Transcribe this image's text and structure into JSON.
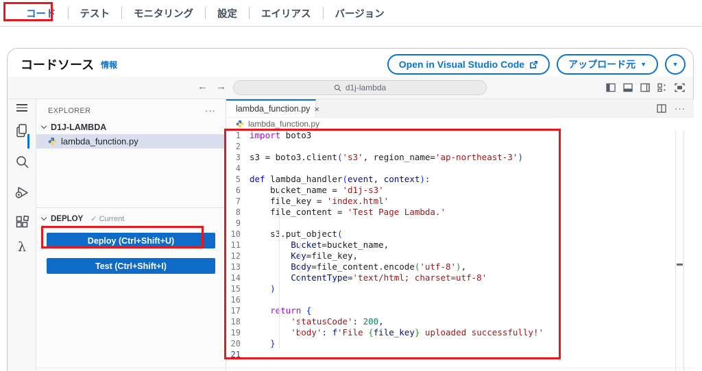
{
  "nav": {
    "tabs": [
      {
        "label": "コード",
        "active": true
      },
      {
        "label": "テスト"
      },
      {
        "label": "モニタリング"
      },
      {
        "label": "設定"
      },
      {
        "label": "エイリアス"
      },
      {
        "label": "バージョン"
      }
    ]
  },
  "header": {
    "title": "コードソース",
    "info_link": "情報",
    "open_vscode_button": "Open in Visual Studio Code",
    "upload_button": "アップロード元"
  },
  "toolbar": {
    "search_value": "d1j-lambda"
  },
  "explorer": {
    "header": "EXPLORER",
    "folder": "D1J-LAMBDA",
    "file": "lambda_function.py",
    "deploy_label": "DEPLOY",
    "deploy_status": "Current",
    "deploy_button": "Deploy (Ctrl+Shift+U)",
    "test_button": "Test (Ctrl+Shift+I)"
  },
  "editor": {
    "tab_label": "lambda_function.py",
    "breadcrumb": "lambda_function.py",
    "lines": [
      {
        "n": 1,
        "t": [
          [
            "kw1",
            "import"
          ],
          [
            "def",
            " boto3"
          ]
        ]
      },
      {
        "n": 2,
        "t": []
      },
      {
        "n": 3,
        "t": [
          [
            "def",
            "s3 = boto3."
          ],
          [
            "fn",
            "client"
          ],
          [
            "br1",
            "("
          ],
          [
            "str",
            "'s3'"
          ],
          [
            "def",
            ", region_name="
          ],
          [
            "str",
            "'ap-northeast-3'"
          ],
          [
            "br1",
            ")"
          ]
        ]
      },
      {
        "n": 4,
        "t": []
      },
      {
        "n": 5,
        "t": [
          [
            "kw2",
            "def "
          ],
          [
            "fn",
            "lambda_handler"
          ],
          [
            "br1",
            "("
          ],
          [
            "var",
            "event"
          ],
          [
            "def",
            ", "
          ],
          [
            "var",
            "context"
          ],
          [
            "br1",
            ")"
          ],
          [
            "def",
            ":"
          ]
        ]
      },
      {
        "n": 6,
        "t": [
          [
            "def",
            "    bucket_name = "
          ],
          [
            "str",
            "'d1j-s3'"
          ]
        ]
      },
      {
        "n": 7,
        "t": [
          [
            "def",
            "    file_key = "
          ],
          [
            "str",
            "'index.html'"
          ]
        ]
      },
      {
        "n": 8,
        "t": [
          [
            "def",
            "    file_content = "
          ],
          [
            "str",
            "'Test Page Lambda.'"
          ]
        ]
      },
      {
        "n": 9,
        "t": []
      },
      {
        "n": 10,
        "t": [
          [
            "def",
            "    s3."
          ],
          [
            "fn",
            "put_object"
          ],
          [
            "br1",
            "("
          ]
        ]
      },
      {
        "n": 11,
        "t": [
          [
            "var",
            "        Bucket"
          ],
          [
            "def",
            "=bucket_name,"
          ]
        ]
      },
      {
        "n": 12,
        "t": [
          [
            "var",
            "        Key"
          ],
          [
            "def",
            "=file_key,"
          ]
        ]
      },
      {
        "n": 13,
        "t": [
          [
            "var",
            "        Body"
          ],
          [
            "def",
            "=file_content."
          ],
          [
            "fn",
            "encode"
          ],
          [
            "br2",
            "("
          ],
          [
            "str",
            "'utf-8'"
          ],
          [
            "br2",
            ")"
          ],
          [
            "def",
            ","
          ]
        ]
      },
      {
        "n": 14,
        "t": [
          [
            "var",
            "        ContentType"
          ],
          [
            "def",
            "="
          ],
          [
            "str",
            "'text/html; charset=utf-8'"
          ]
        ]
      },
      {
        "n": 15,
        "t": [
          [
            "def",
            "    "
          ],
          [
            "br1",
            ")"
          ]
        ]
      },
      {
        "n": 16,
        "t": []
      },
      {
        "n": 17,
        "t": [
          [
            "kw1",
            "    return "
          ],
          [
            "br1",
            "{"
          ]
        ]
      },
      {
        "n": 18,
        "t": [
          [
            "def",
            "        "
          ],
          [
            "str",
            "'statusCode'"
          ],
          [
            "def",
            ": "
          ],
          [
            "num",
            "200"
          ],
          [
            "def",
            ","
          ]
        ]
      },
      {
        "n": 19,
        "t": [
          [
            "def",
            "        "
          ],
          [
            "str",
            "'body'"
          ],
          [
            "def",
            ": "
          ],
          [
            "kw2",
            "f"
          ],
          [
            "str",
            "'File "
          ],
          [
            "br2",
            "{"
          ],
          [
            "var",
            "file_key"
          ],
          [
            "br2",
            "}"
          ],
          [
            "str",
            " uploaded successfully!'"
          ]
        ]
      },
      {
        "n": 20,
        "t": [
          [
            "def",
            "    "
          ],
          [
            "br1",
            "}"
          ]
        ]
      },
      {
        "n": 21,
        "t": [],
        "active": true
      }
    ]
  },
  "icons": {
    "caret_down": "▼",
    "check": "✓",
    "more": "···",
    "close": "×",
    "arrow_left": "←",
    "arrow_right": "→",
    "lambda": "λ"
  },
  "colors": {
    "aws_blue": "#0972d3",
    "vscode_button_blue": "#0e6cc8",
    "annotation_red": "#e4181d",
    "keyword_purple": "#af00db",
    "keyword_blue": "#0000ff",
    "string_red": "#a31515",
    "number_green": "#098658",
    "variable_navy": "#001080",
    "selected_file_bg": "#dadeef"
  }
}
